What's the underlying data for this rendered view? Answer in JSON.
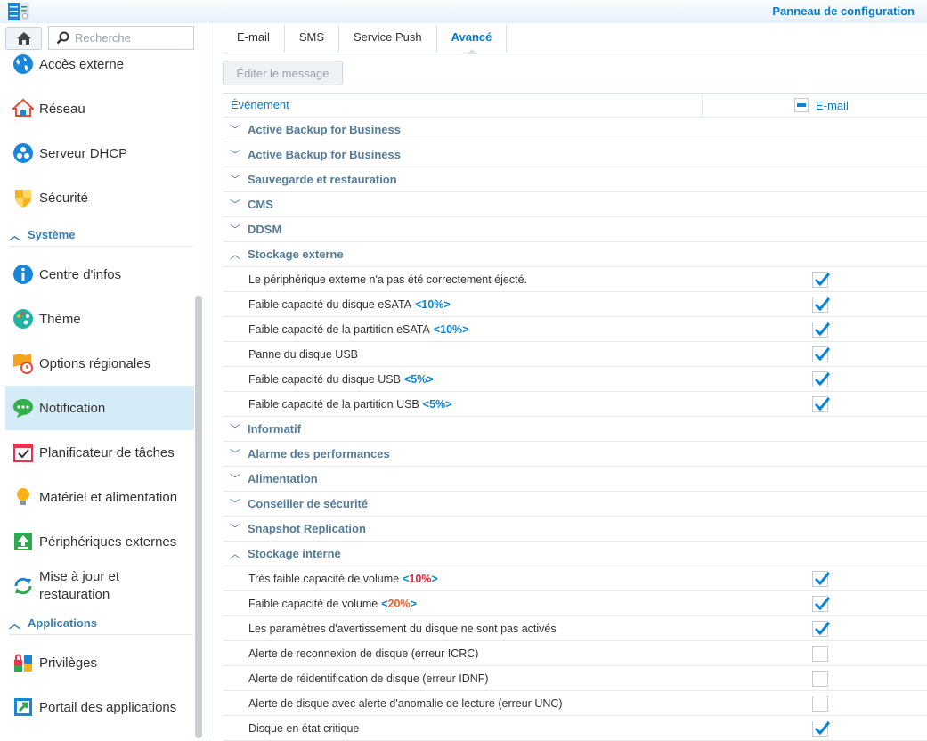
{
  "title": "Panneau de configuration",
  "search": {
    "placeholder": "Recherche"
  },
  "sidebar": {
    "items": [
      {
        "label": "Accès externe",
        "icon": "globe-icon"
      },
      {
        "label": "Réseau",
        "icon": "house-network-icon"
      },
      {
        "label": "Serveur DHCP",
        "icon": "dhcp-icon"
      },
      {
        "label": "Sécurité",
        "icon": "shield-icon"
      },
      {
        "label": "Centre d'infos",
        "icon": "info-icon"
      },
      {
        "label": "Thème",
        "icon": "palette-icon"
      },
      {
        "label": "Options régionales",
        "icon": "map-clock-icon"
      },
      {
        "label": "Notification",
        "icon": "chat-bubble-icon"
      },
      {
        "label": "Planificateur de tâches",
        "icon": "calendar-check-icon"
      },
      {
        "label": "Matériel et alimentation",
        "icon": "lightbulb-icon"
      },
      {
        "label": "Périphériques externes",
        "icon": "upload-icon"
      },
      {
        "label": "Mise à jour et",
        "label2": "restauration",
        "icon": "refresh-icon"
      },
      {
        "label": "Privilèges",
        "icon": "lock-grid-icon"
      },
      {
        "label": "Portail des applications",
        "icon": "arrow-portal-icon"
      }
    ],
    "sections": [
      "Système",
      "Applications"
    ]
  },
  "tabs": [
    "E-mail",
    "SMS",
    "Service Push",
    "Avancé"
  ],
  "active_tab": "Avancé",
  "edit_button": "Éditer le message",
  "table": {
    "headers": [
      "Événement",
      "E-mail"
    ],
    "bracket_open": "<",
    "bracket_close": ">",
    "rows": [
      {
        "type": "group",
        "label": "Active Backup for Business",
        "expanded": false
      },
      {
        "type": "group",
        "label": "Active Backup for Business",
        "expanded": false
      },
      {
        "type": "group",
        "label": "Sauvegarde et restauration",
        "expanded": false
      },
      {
        "type": "group",
        "label": "CMS",
        "expanded": false
      },
      {
        "type": "group",
        "label": "DDSM",
        "expanded": false
      },
      {
        "type": "group",
        "label": "Stockage externe",
        "expanded": true
      },
      {
        "type": "item",
        "label": "Le périphérique externe n'a pas été correctement éjecté.",
        "checked": true
      },
      {
        "type": "item",
        "label": "Faible capacité du disque eSATA",
        "threshold": "10%",
        "threshold_color": "#0a84d6",
        "checked": true
      },
      {
        "type": "item",
        "label": "Faible capacité de la partition eSATA",
        "threshold": "10%",
        "threshold_color": "#0a84d6",
        "checked": true
      },
      {
        "type": "item",
        "label": "Panne du disque USB",
        "checked": true
      },
      {
        "type": "item",
        "label": "Faible capacité du disque USB",
        "threshold": "5%",
        "threshold_color": "#0a84d6",
        "checked": true
      },
      {
        "type": "item",
        "label": "Faible capacité de la partition USB",
        "threshold": "5%",
        "threshold_color": "#0a84d6",
        "checked": true
      },
      {
        "type": "group",
        "label": "Informatif",
        "expanded": false
      },
      {
        "type": "group",
        "label": "Alarme des performances",
        "expanded": false
      },
      {
        "type": "group",
        "label": "Alimentation",
        "expanded": false
      },
      {
        "type": "group",
        "label": "Conseiller de sécurité",
        "expanded": false
      },
      {
        "type": "group",
        "label": "Snapshot Replication",
        "expanded": false
      },
      {
        "type": "group",
        "label": "Stockage interne",
        "expanded": true
      },
      {
        "type": "item",
        "label": "Très faible capacité de volume",
        "threshold": "10%",
        "threshold_color": "#f0243c",
        "checked": true
      },
      {
        "type": "item",
        "label": "Faible capacité de volume",
        "threshold": "20%",
        "threshold_color": "#f5602a",
        "checked": true
      },
      {
        "type": "item",
        "label": "Les paramètres d'avertissement du disque ne sont pas activés",
        "checked": true
      },
      {
        "type": "item",
        "label": "Alerte de reconnexion de disque (erreur ICRC)",
        "checked": false
      },
      {
        "type": "item",
        "label": "Alerte de réidentification de disque (erreur IDNF)",
        "checked": false
      },
      {
        "type": "item",
        "label": "Alerte de disque avec alerte d'anomalie de lecture (erreur UNC)",
        "checked": false
      },
      {
        "type": "item",
        "label": "Disque en état critique",
        "checked": true
      }
    ]
  }
}
